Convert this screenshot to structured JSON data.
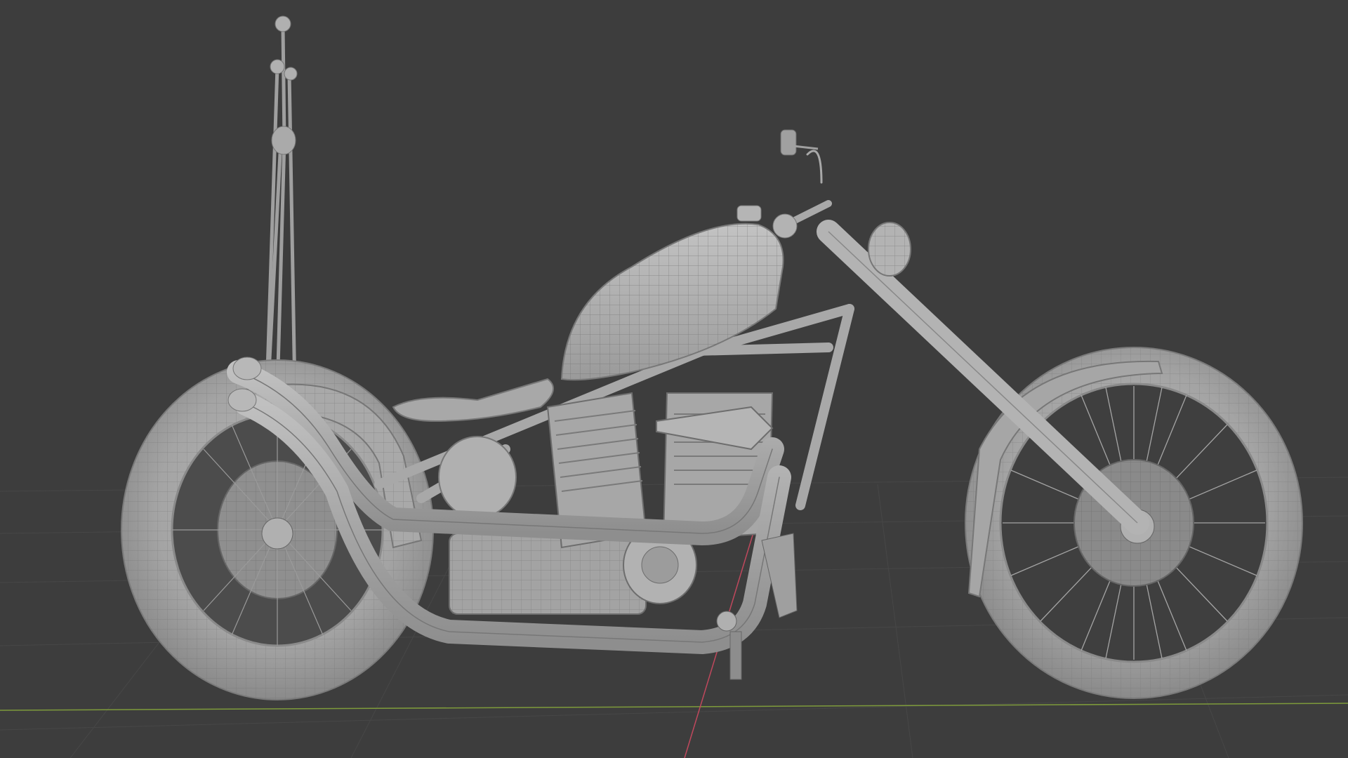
{
  "viewport": {
    "background": "#3d3d3d",
    "grid_color": "#474747",
    "x_axis_color": "#7e9b3b",
    "y_axis_color": "#c0485d",
    "shading": "solid",
    "overlay": "wireframe"
  },
  "model": {
    "type": "chopper motorcycle",
    "base_color": "#a3a3a3",
    "light_color": "#bdbdbd",
    "shadow_color": "#7a7a7a"
  }
}
